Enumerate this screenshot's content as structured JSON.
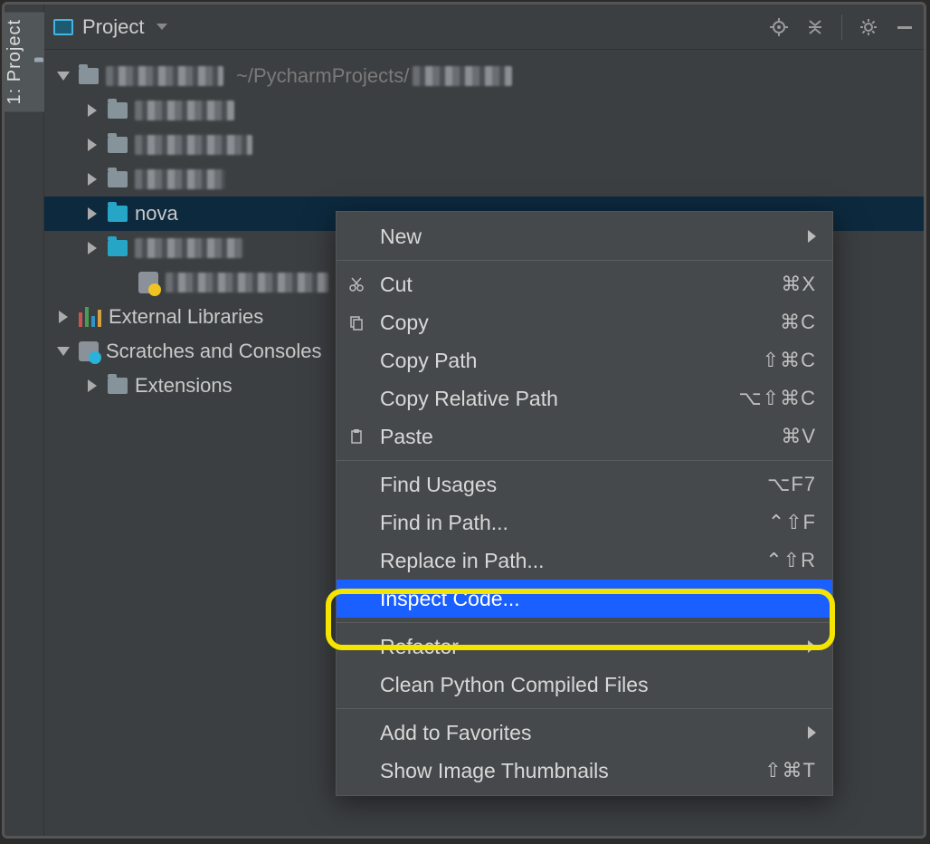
{
  "rail": {
    "tab_label": "1: Project"
  },
  "header": {
    "title": "Project"
  },
  "tree": {
    "root_path": "~/PycharmProjects/",
    "selected_folder": "nova",
    "external_libs": "External Libraries",
    "scratches": "Scratches and Consoles",
    "extensions": "Extensions"
  },
  "context_menu": {
    "items": [
      {
        "label": "New",
        "submenu": true
      },
      {
        "sep": true
      },
      {
        "label": "Cut",
        "icon": "cut",
        "shortcut": "⌘X"
      },
      {
        "label": "Copy",
        "icon": "copy",
        "shortcut": "⌘C"
      },
      {
        "label": "Copy Path",
        "shortcut": "⇧⌘C"
      },
      {
        "label": "Copy Relative Path",
        "shortcut": "⌥⇧⌘C"
      },
      {
        "label": "Paste",
        "icon": "paste",
        "shortcut": "⌘V"
      },
      {
        "sep": true
      },
      {
        "label": "Find Usages",
        "shortcut": "⌥F7"
      },
      {
        "label": "Find in Path...",
        "shortcut": "⌃⇧F"
      },
      {
        "label": "Replace in Path...",
        "shortcut": "⌃⇧R"
      },
      {
        "label": "Inspect Code...",
        "highlight": true
      },
      {
        "sep": true
      },
      {
        "label": "Refactor",
        "submenu": true
      },
      {
        "label": "Clean Python Compiled Files"
      },
      {
        "sep": true
      },
      {
        "label": "Add to Favorites",
        "submenu": true
      },
      {
        "label": "Show Image Thumbnails",
        "shortcut": "⇧⌘T"
      }
    ]
  }
}
